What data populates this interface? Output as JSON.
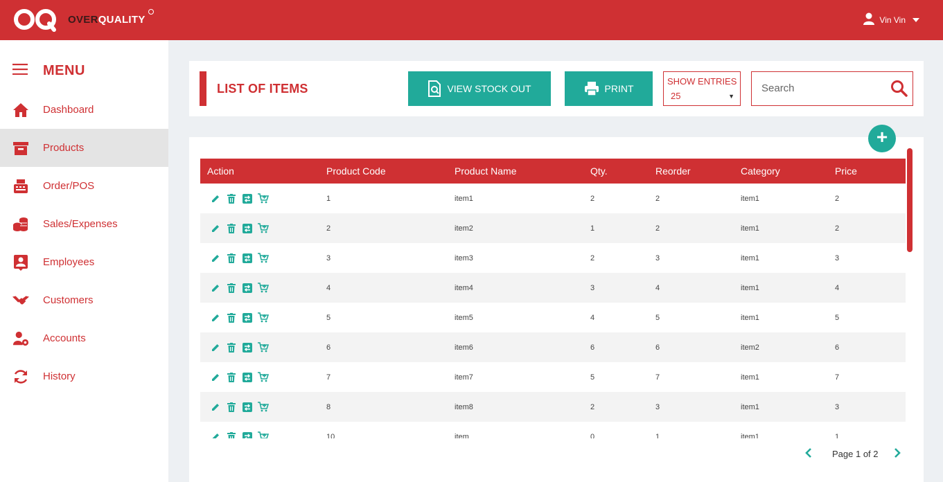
{
  "brand": {
    "over": "OVER",
    "quality": "QUALITY"
  },
  "user": {
    "name": "Vin Vin"
  },
  "sidebar": {
    "title": "MENU",
    "items": [
      {
        "label": "Dashboard",
        "icon": "home-icon",
        "active": false
      },
      {
        "label": "Products",
        "icon": "archive-box-icon",
        "active": true
      },
      {
        "label": "Order/POS",
        "icon": "cash-register-icon",
        "active": false
      },
      {
        "label": "Sales/Expenses",
        "icon": "coins-icon",
        "active": false
      },
      {
        "label": "Employees",
        "icon": "id-badge-icon",
        "active": false
      },
      {
        "label": "Customers",
        "icon": "handshake-icon",
        "active": false
      },
      {
        "label": "Accounts",
        "icon": "user-gear-icon",
        "active": false
      },
      {
        "label": "History",
        "icon": "sync-icon",
        "active": false
      }
    ]
  },
  "header": {
    "title": "LIST OF ITEMS",
    "view_stock_out": "VIEW STOCK OUT",
    "print": "PRINT",
    "show_entries_label": "SHOW ENTRIES",
    "show_entries_value": "25",
    "search_placeholder": "Search"
  },
  "table": {
    "columns": [
      "Action",
      "Product Code",
      "Product Name",
      "Qty.",
      "Reorder",
      "Category",
      "Price"
    ],
    "rows": [
      [
        "1",
        "item1",
        "2",
        "2",
        "item1",
        "2"
      ],
      [
        "2",
        "item2",
        "1",
        "2",
        "item1",
        "2"
      ],
      [
        "3",
        "item3",
        "2",
        "3",
        "item1",
        "3"
      ],
      [
        "4",
        "item4",
        "3",
        "4",
        "item1",
        "4"
      ],
      [
        "5",
        "item5",
        "4",
        "5",
        "item1",
        "5"
      ],
      [
        "6",
        "item6",
        "6",
        "6",
        "item2",
        "6"
      ],
      [
        "7",
        "item7",
        "5",
        "7",
        "item1",
        "7"
      ],
      [
        "8",
        "item8",
        "2",
        "3",
        "item1",
        "3"
      ],
      [
        "10",
        "item",
        "0",
        "1",
        "item1",
        "1"
      ]
    ]
  },
  "pagination": {
    "text": "Page 1 of 2"
  },
  "colors": {
    "brand_red": "#cf3033",
    "teal": "#21aa9a"
  }
}
